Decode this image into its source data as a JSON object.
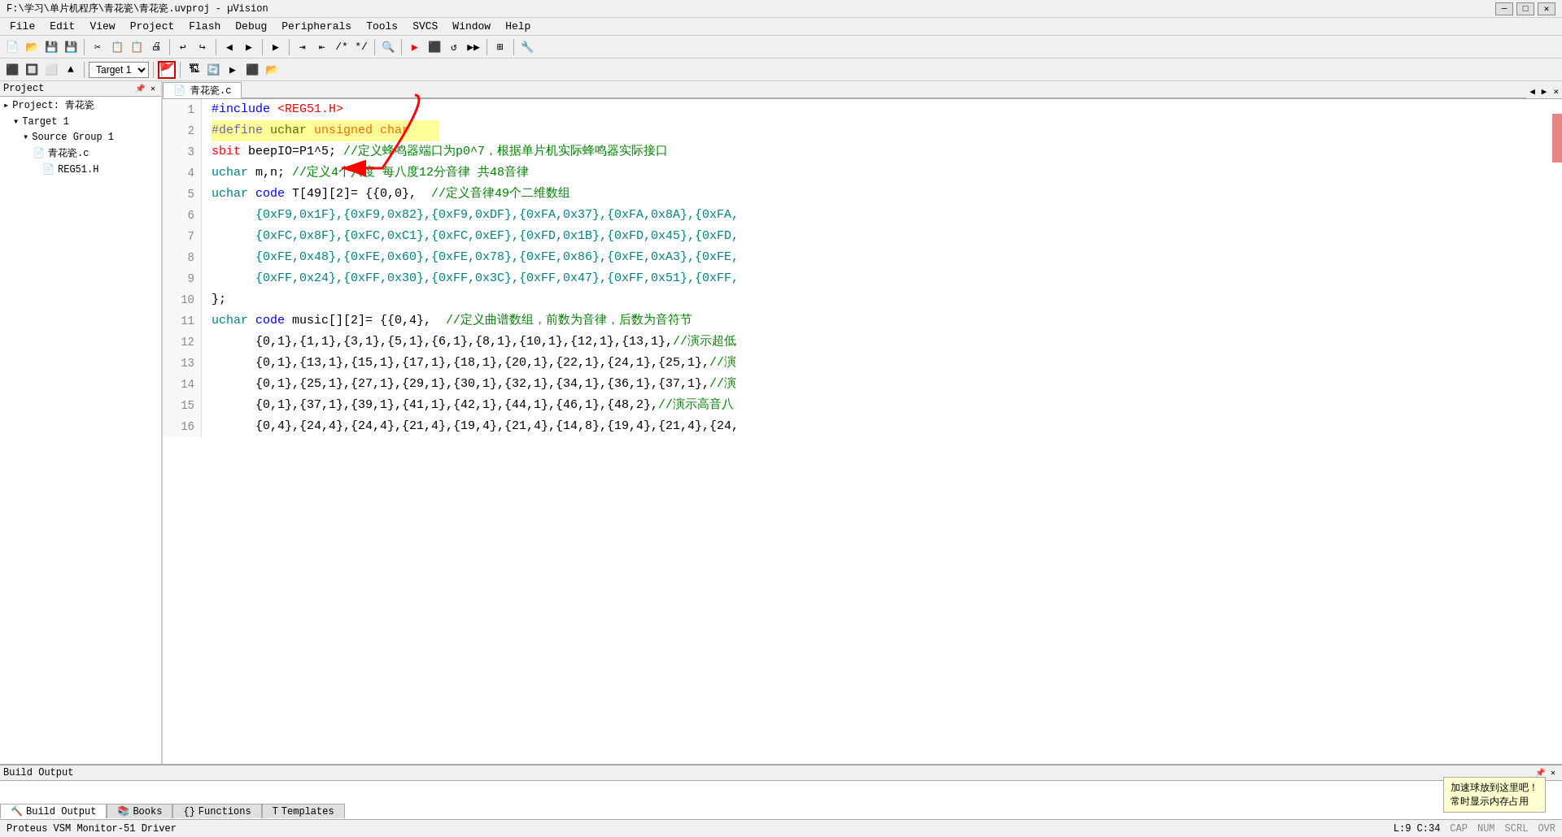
{
  "titlebar": {
    "title": "F:\\学习\\单片机程序\\青花瓷\\青花瓷.uvproj - µVision",
    "min_label": "─",
    "max_label": "□",
    "close_label": "✕"
  },
  "menubar": {
    "items": [
      "File",
      "Edit",
      "View",
      "Project",
      "Flash",
      "Debug",
      "Peripherals",
      "Tools",
      "SVCS",
      "Window",
      "Help"
    ]
  },
  "toolbar": {
    "target_label": "Target 1"
  },
  "project_panel": {
    "title": "Project",
    "items": [
      {
        "label": "Project: 青花瓷",
        "indent": 0,
        "icon": "▸"
      },
      {
        "label": "Target 1",
        "indent": 1,
        "icon": "▾"
      },
      {
        "label": "Source Group 1",
        "indent": 2,
        "icon": "▾"
      },
      {
        "label": "青花瓷.c",
        "indent": 3,
        "icon": "📄"
      },
      {
        "label": "REG51.H",
        "indent": 4,
        "icon": "📄"
      }
    ]
  },
  "editor": {
    "tab_name": "青花瓷.c",
    "lines": [
      {
        "num": 1,
        "content": "#include <REG51.H>"
      },
      {
        "num": 2,
        "content": "#define uchar unsigned char"
      },
      {
        "num": 3,
        "content": "sbit beepIO=P1^5; //定义蜂鸣器端口为p0^7，根据单片机实际蜂鸣器实际接口"
      },
      {
        "num": 4,
        "content": "uchar m,n; //定义4个八度 每八度12分音律 共48音律"
      },
      {
        "num": 5,
        "content": "uchar code T[49][2]= {{0,0},  //定义音律49个二维数组"
      },
      {
        "num": 6,
        "content": "      {0xF9,0x1F},{0xF9,0x82},{0xF9,0xDF},{0xFA,0x37},{0xFA,0x8A},{0xFA,"
      },
      {
        "num": 7,
        "content": "      {0xFC,0x8F},{0xFC,0xC1},{0xFC,0xEF},{0xFD,0x1B},{0xFD,0x45},{0xFD,"
      },
      {
        "num": 8,
        "content": "      {0xFE,0x48},{0xFE,0x60},{0xFE,0x78},{0xFE,0x86},{0xFE,0xA3},{0xFE,"
      },
      {
        "num": 9,
        "content": "      {0xFF,0x24},{0xFF,0x30},{0xFF,0x3C},{0xFF,0x47},{0xFF,0x51},{0xFF,"
      },
      {
        "num": 10,
        "content": "};"
      },
      {
        "num": 11,
        "content": "uchar code music[][2]= {{0,4},  //定义曲谱数组，前数为音律，后数为音符节"
      },
      {
        "num": 12,
        "content": "      {0,1},{1,1},{3,1},{5,1},{6,1},{8,1},{10,1},{12,1},{13,1},//演示超低"
      },
      {
        "num": 13,
        "content": "      {0,1},{13,1},{15,1},{17,1},{18,1},{20,1},{22,1},{24,1},{25,1},//演"
      },
      {
        "num": 14,
        "content": "      {0,1},{25,1},{27,1},{29,1},{30,1},{32,1},{34,1},{36,1},{37,1},//演"
      },
      {
        "num": 15,
        "content": "      {0,1},{37,1},{39,1},{41,1},{42,1},{44,1},{46,1},{48,2},//演示高音八"
      },
      {
        "num": 16,
        "content": "      {0,4},{24,4},{24,4},{21,4},{19,4},{21,4},{14,8},{19,4},{21,4},{24,"
      }
    ]
  },
  "build_output": {
    "title": "Build Output",
    "content": ""
  },
  "bottom_tabs": [
    {
      "label": "Build Output",
      "icon": "🔨",
      "active": true
    },
    {
      "label": "Books",
      "icon": "📚"
    },
    {
      "label": "Functions",
      "icon": "{}",
      "active": false
    },
    {
      "label": "Templates",
      "icon": "T",
      "active": false
    }
  ],
  "status_bar": {
    "left": "Proteus VSM Monitor-51 Driver",
    "right": "L:9 C:34",
    "caps": "CAP",
    "num": "NUM",
    "scrl": "SCRL",
    "ovr": "OVR"
  },
  "tooltip": {
    "line1": "加速球放到这里吧！",
    "line2": "常时显示内存占用"
  }
}
